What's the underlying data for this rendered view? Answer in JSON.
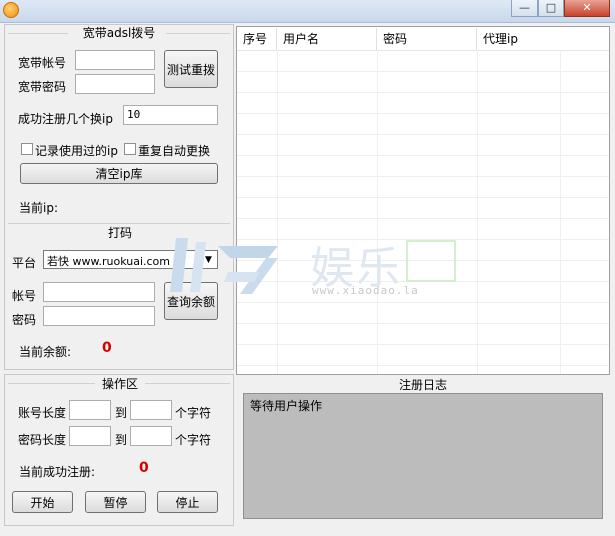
{
  "window": {
    "minimize": "—",
    "maximize": "□",
    "close": "✕"
  },
  "adsl": {
    "title": "宽带adsl拨号",
    "account_label": "宽带帐号",
    "account_value": "",
    "password_label": "宽带密码",
    "password_value": "",
    "test_redial_button": "测试重拨",
    "switch_label": "成功注册几个换ip",
    "switch_value": "10",
    "record_used_ip": "记录使用过的ip",
    "auto_replace": "重复自动更换",
    "clear_ip_button": "清空ip库",
    "current_ip_label": "当前ip:"
  },
  "captcha": {
    "title": "打码",
    "platform_label": "平台",
    "platform_value": "若快 www.ruokuai.com",
    "account_label": "帐号",
    "password_label": "密码",
    "query_button": "查询余额",
    "balance_label": "当前余额:",
    "balance_value": "0"
  },
  "ops": {
    "title": "操作区",
    "account_len_label": "账号长度",
    "password_len_label": "密码长度",
    "to": "到",
    "chars": "个字符",
    "success_label": "当前成功注册:",
    "success_value": "0",
    "start": "开始",
    "pause": "暂停",
    "stop": "停止"
  },
  "table": {
    "columns": [
      "序号",
      "用户名",
      "密码",
      "代理ip"
    ],
    "rows": []
  },
  "log": {
    "title": "注册日志",
    "text": "等待用户操作"
  },
  "watermark": {
    "brand": "娱乐",
    "url": "www.xiaodao.la"
  }
}
